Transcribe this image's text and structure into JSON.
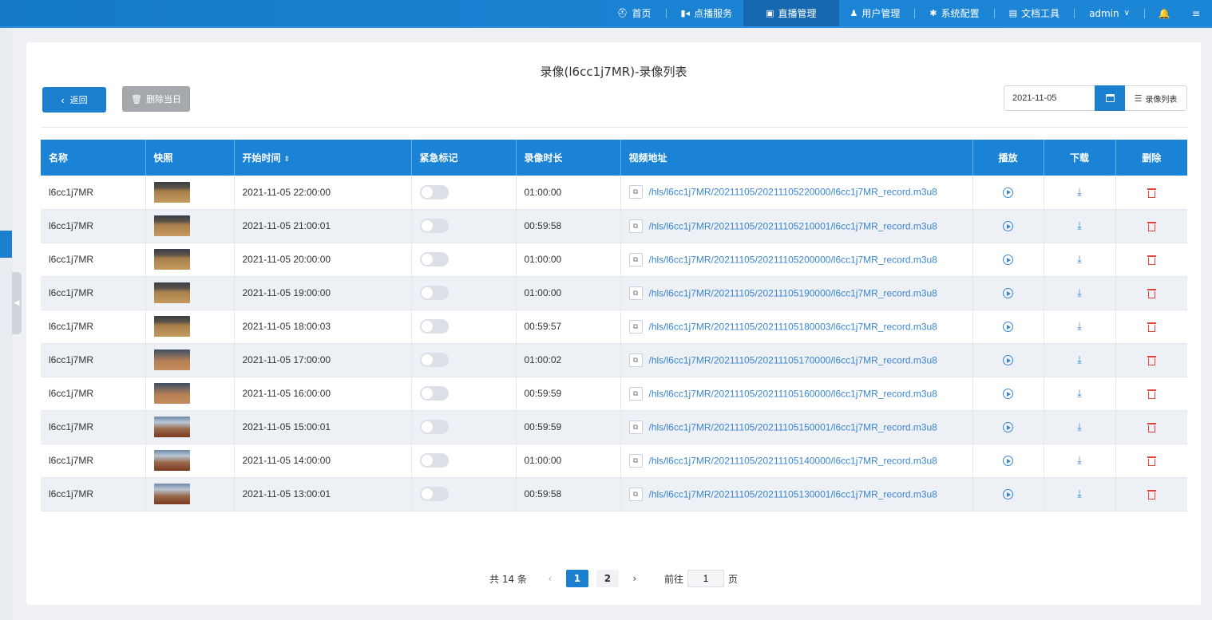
{
  "nav": {
    "items": [
      {
        "icon": "⛑",
        "label": "首页"
      },
      {
        "icon": "▮◂",
        "label": "点播服务"
      },
      {
        "icon": "▣",
        "label": "直播管理",
        "active": true
      },
      {
        "icon": "♟",
        "label": "用户管理"
      },
      {
        "icon": "✱",
        "label": "系统配置"
      },
      {
        "icon": "▤",
        "label": "文档工具"
      }
    ],
    "user": "admin",
    "user_chevron": "∨",
    "bell": "🔔",
    "menu": "≡"
  },
  "page": {
    "title": "录像(l6cc1j7MR)-录像列表",
    "back_label": "返回",
    "back_icon": "‹",
    "delete_day_label": "删除当日",
    "delete_day_icon": "🗑",
    "date_value": "2021-11-05",
    "list_button_label": "录像列表",
    "list_button_icon": "☰"
  },
  "table": {
    "headers": {
      "name": "名称",
      "snapshot": "快照",
      "start_time": "开始时间",
      "sort_icon": "⇕",
      "urgent": "紧急标记",
      "duration": "录像时长",
      "url": "视频地址",
      "play": "播放",
      "download": "下载",
      "delete": "删除"
    },
    "copy_icon": "⧉",
    "download_glyph": "⤓",
    "rows": [
      {
        "name": "l6cc1j7MR",
        "thumb": "a",
        "start": "2021-11-05 22:00:00",
        "duration": "01:00:00",
        "url": "/hls/l6cc1j7MR/20211105/20211105220000/l6cc1j7MR_record.m3u8"
      },
      {
        "name": "l6cc1j7MR",
        "thumb": "a",
        "start": "2021-11-05 21:00:01",
        "duration": "00:59:58",
        "url": "/hls/l6cc1j7MR/20211105/20211105210001/l6cc1j7MR_record.m3u8"
      },
      {
        "name": "l6cc1j7MR",
        "thumb": "a",
        "start": "2021-11-05 20:00:00",
        "duration": "01:00:00",
        "url": "/hls/l6cc1j7MR/20211105/20211105200000/l6cc1j7MR_record.m3u8"
      },
      {
        "name": "l6cc1j7MR",
        "thumb": "a",
        "start": "2021-11-05 19:00:00",
        "duration": "01:00:00",
        "url": "/hls/l6cc1j7MR/20211105/20211105190000/l6cc1j7MR_record.m3u8"
      },
      {
        "name": "l6cc1j7MR",
        "thumb": "a",
        "start": "2021-11-05 18:00:03",
        "duration": "00:59:57",
        "url": "/hls/l6cc1j7MR/20211105/20211105180003/l6cc1j7MR_record.m3u8"
      },
      {
        "name": "l6cc1j7MR",
        "thumb": "b",
        "start": "2021-11-05 17:00:00",
        "duration": "01:00:02",
        "url": "/hls/l6cc1j7MR/20211105/20211105170000/l6cc1j7MR_record.m3u8"
      },
      {
        "name": "l6cc1j7MR",
        "thumb": "b",
        "start": "2021-11-05 16:00:00",
        "duration": "00:59:59",
        "url": "/hls/l6cc1j7MR/20211105/20211105160000/l6cc1j7MR_record.m3u8"
      },
      {
        "name": "l6cc1j7MR",
        "thumb": "c",
        "start": "2021-11-05 15:00:01",
        "duration": "00:59:59",
        "url": "/hls/l6cc1j7MR/20211105/20211105150001/l6cc1j7MR_record.m3u8"
      },
      {
        "name": "l6cc1j7MR",
        "thumb": "c",
        "start": "2021-11-05 14:00:00",
        "duration": "01:00:00",
        "url": "/hls/l6cc1j7MR/20211105/20211105140000/l6cc1j7MR_record.m3u8"
      },
      {
        "name": "l6cc1j7MR",
        "thumb": "c",
        "start": "2021-11-05 13:00:01",
        "duration": "00:59:58",
        "url": "/hls/l6cc1j7MR/20211105/20211105130001/l6cc1j7MR_record.m3u8"
      }
    ]
  },
  "pagination": {
    "total_text": "共 14 条",
    "prev": "‹",
    "pages": [
      "1",
      "2"
    ],
    "active_page": "1",
    "next": "›",
    "goto_prefix": "前往",
    "goto_value": "1",
    "goto_suffix": "页"
  },
  "colors": {
    "primary": "#1b7fd0",
    "header": "#1b83d6",
    "link": "#3a86cf",
    "danger": "#e0463c"
  }
}
